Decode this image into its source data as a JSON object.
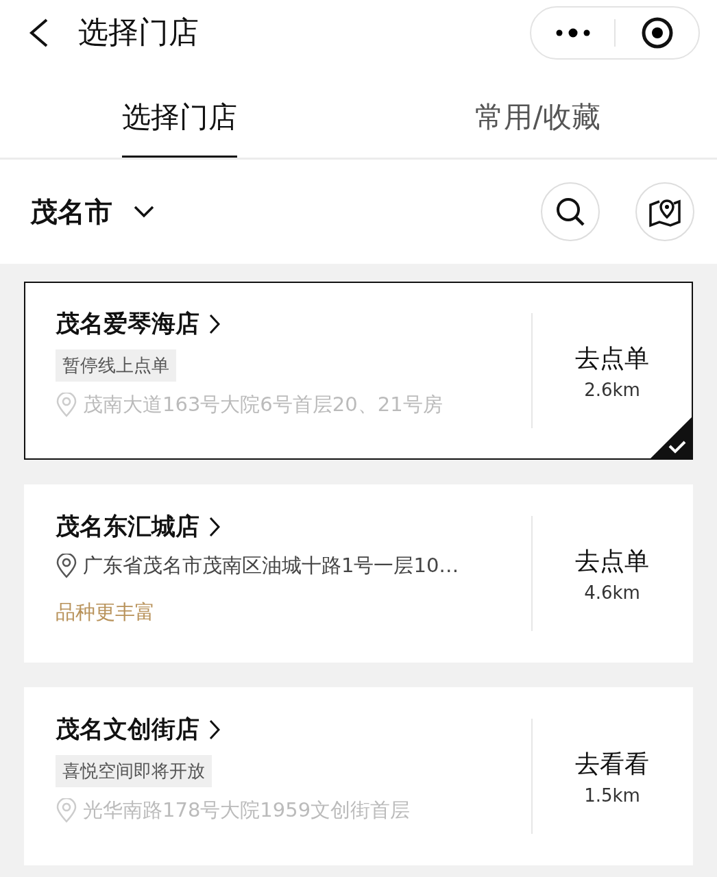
{
  "header": {
    "title": "选择门店"
  },
  "tabs": [
    {
      "label": "选择门店",
      "selected": true
    },
    {
      "label": "常用/收藏",
      "selected": false
    }
  ],
  "city": {
    "name": "茂名市"
  },
  "stores": [
    {
      "name": "茂名爱琴海店",
      "tag": "暂停线上点单",
      "address": "茂南大道163号大院6号首层20、21号房",
      "disabled": true,
      "action": "去点单",
      "distance": "2.6km",
      "selected": true
    },
    {
      "name": "茂名东汇城店",
      "address": "广东省茂名市茂南区油城十路1号一层10…",
      "highlight": "品种更丰富",
      "disabled": false,
      "action": "去点单",
      "distance": "4.6km",
      "selected": false
    },
    {
      "name": "茂名文创街店",
      "tag": "喜悦空间即将开放",
      "address": "光华南路178号大院1959文创街首层",
      "disabled": true,
      "action": "去看看",
      "distance": "1.5km",
      "selected": false
    }
  ]
}
